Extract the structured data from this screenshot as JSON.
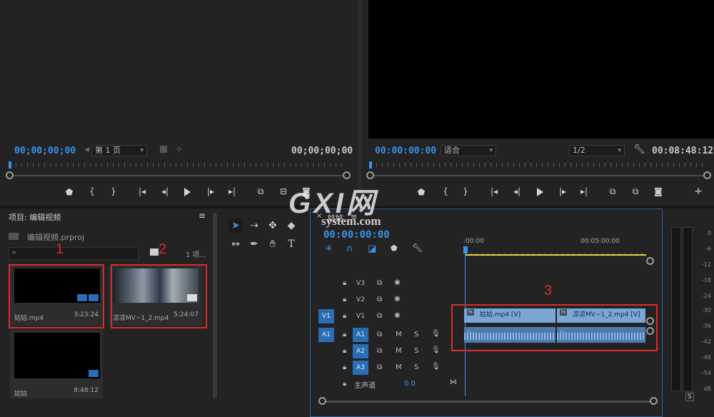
{
  "source_monitor": {
    "timecode_left": "00;00;00;00",
    "page_select": "第 1 页",
    "timecode_right": "00;00;00;00"
  },
  "program_monitor": {
    "timecode_left": "00:00:00:00",
    "fit_select": "适合",
    "resolution_select": "1/2",
    "timecode_right": "00:08:48:12"
  },
  "project_panel": {
    "title": "项目: 编辑视频",
    "menu_icon": "≡",
    "project_file": "编辑视频.prproj",
    "search_placeholder": "",
    "item_count": "1 项...",
    "items": [
      {
        "name": "姑姑.mp4",
        "duration": "3:23:24"
      },
      {
        "name": "凉凉MV~1_2.mp4",
        "duration": "5:24:07"
      },
      {
        "name": "姑姑",
        "duration": "8:48:12"
      }
    ]
  },
  "timeline": {
    "sequence_name": "姑姑",
    "menu_icon": "≡",
    "timecode": "00:00:00:00",
    "ruler_labels": [
      ":00:00",
      "00:05:00:00"
    ],
    "tracks": [
      {
        "name": "V3",
        "type": "video"
      },
      {
        "name": "V2",
        "type": "video"
      },
      {
        "name": "V1",
        "type": "video",
        "source": "V1"
      },
      {
        "name": "A1",
        "type": "audio",
        "source": "A1"
      },
      {
        "name": "A2",
        "type": "audio"
      },
      {
        "name": "A3",
        "type": "audio"
      }
    ],
    "track_buttons": {
      "mute": "M",
      "solo": "S"
    },
    "master_label": "主声道",
    "master_value": "0.0",
    "clips": [
      {
        "label": "姑姑.mp4 [V]"
      },
      {
        "label": "凉凉MV~1_2.mp4 [V]"
      }
    ]
  },
  "audio_meter": {
    "db_labels": [
      "0",
      "-6",
      "-12",
      "-18",
      "-24",
      "-30",
      "-36",
      "-42",
      "-48",
      "-54",
      "dB"
    ],
    "solo_label": "S"
  },
  "annotations": {
    "one": "1",
    "two": "2",
    "three": "3"
  },
  "watermark": {
    "logo": "GXI网",
    "site": "system.com"
  },
  "colors": {
    "accent_blue": "#3d8fe8",
    "annotation_red": "#d92c2c",
    "clip_blue": "#7aa6d6",
    "playhead_line": "#e8d13a"
  }
}
